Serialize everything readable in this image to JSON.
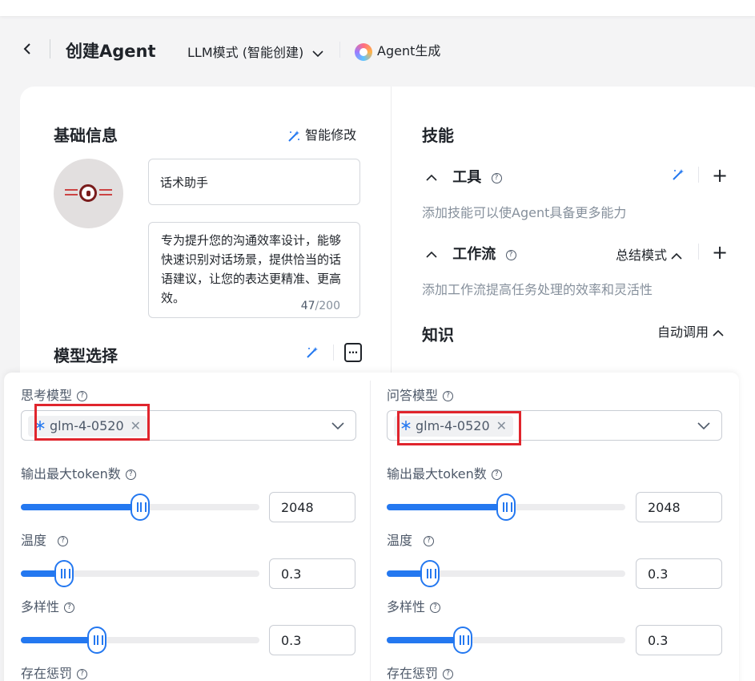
{
  "header": {
    "title": "创建Agent",
    "mode_label": "LLM模式 (智能创建)",
    "generate_label": "Agent生成"
  },
  "basic": {
    "title": "基础信息",
    "smart_edit_label": "智能修改",
    "name_value": "话术助手",
    "description": "专为提升您的沟通效率设计，能够快速识别对话场景，提供恰当的话语建议，让您的表达更精准、更高效。",
    "char_count": "47",
    "char_max": "/200"
  },
  "model_section": {
    "title": "模型选择",
    "more_label": "…"
  },
  "skills": {
    "title": "技能",
    "tools": {
      "label": "工具",
      "hint": "添加技能可以使Agent具备更多能力"
    },
    "workflow": {
      "label": "工作流",
      "mode": "总结模式",
      "hint": "添加工作流提高任务处理的效率和灵活性"
    },
    "knowledge": {
      "label": "知识",
      "mode": "自动调用"
    }
  },
  "panel": {
    "left": {
      "model_label": "思考模型",
      "model_value": "glm-4-0520",
      "max_tokens_label": "输出最大token数",
      "max_tokens_value": "2048",
      "max_tokens_level": 0.5,
      "temperature_label": "温度",
      "temperature_value": "0.3",
      "temperature_level": 0.18,
      "diversity_label": "多样性",
      "diversity_value": "0.3",
      "diversity_level": 0.32,
      "presence_label": "存在惩罚"
    },
    "right": {
      "model_label": "问答模型",
      "model_value": "glm-4-0520",
      "max_tokens_label": "输出最大token数",
      "max_tokens_value": "2048",
      "max_tokens_level": 0.5,
      "temperature_label": "温度",
      "temperature_value": "0.3",
      "temperature_level": 0.18,
      "diversity_label": "多样性",
      "diversity_value": "0.3",
      "diversity_level": 0.32,
      "presence_label": "存在惩罚"
    }
  },
  "colors": {
    "accent": "#2478f0",
    "highlight_box": "#e0252d"
  },
  "icons": {
    "back": "chevron-left-icon",
    "wand": "magic-wand-icon",
    "help": "help-circle-icon",
    "add": "plus-icon",
    "model": "snowflake-model-icon"
  }
}
